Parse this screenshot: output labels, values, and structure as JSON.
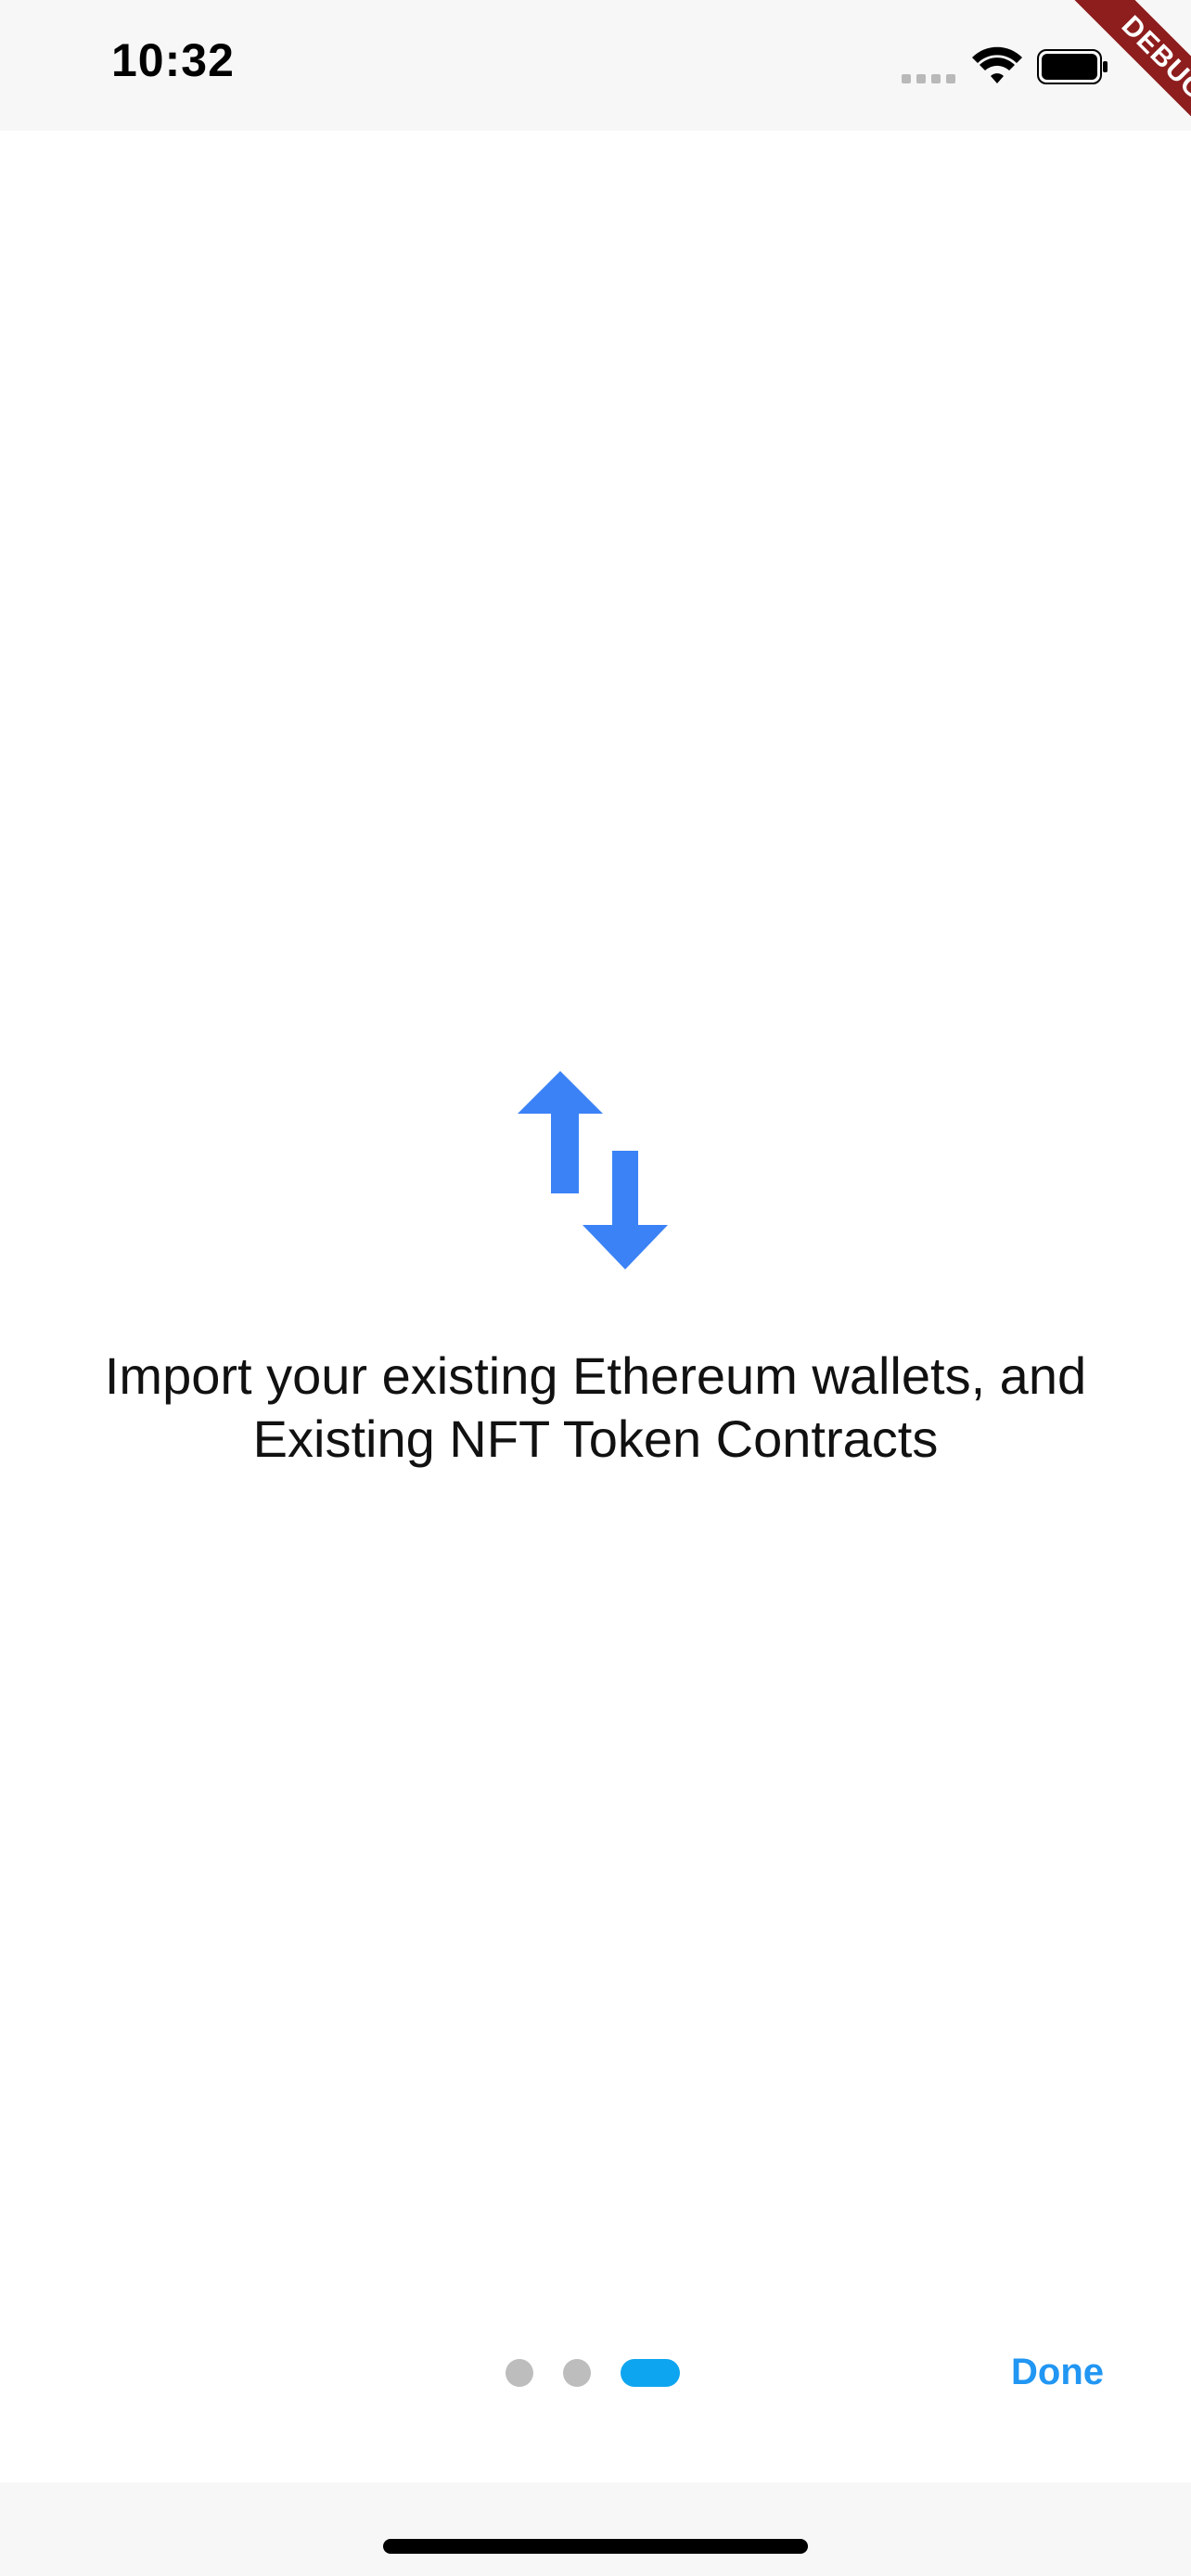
{
  "status_bar": {
    "time": "10:32",
    "signal_icon": "cellular-signal-icon",
    "wifi_icon": "wifi-icon",
    "battery_icon": "battery-icon"
  },
  "debug_banner": {
    "label": "DEBUG"
  },
  "onboarding": {
    "icon": "swap-vertical-icon",
    "icon_color": "#3b82f6",
    "caption": "Import your existing Ethereum wallets, and Existing NFT Token Contracts",
    "page_count": 3,
    "active_page": 3,
    "done_label": "Done",
    "accent_color": "#0ea5f0"
  }
}
